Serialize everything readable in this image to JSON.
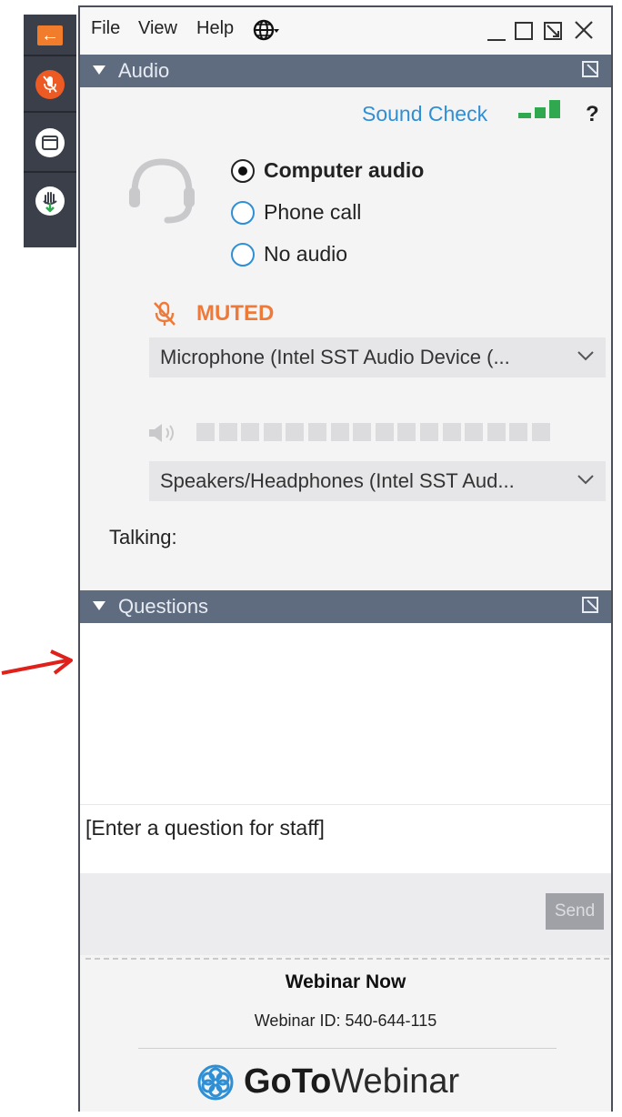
{
  "menubar": {
    "items": [
      "File",
      "View",
      "Help"
    ],
    "language_icon": "globe-icon"
  },
  "side_toolbar": {
    "items": [
      {
        "name": "back-arrow-icon",
        "color": "#f07c2c"
      },
      {
        "name": "microphone-muted-icon",
        "color": "#ee5a24"
      },
      {
        "name": "window-icon",
        "color": "#ffffff"
      },
      {
        "name": "raise-hand-icon",
        "color": "#2fa84f"
      }
    ]
  },
  "audio": {
    "header": "Audio",
    "sound_check": "Sound Check",
    "help": "?",
    "options": [
      {
        "label": "Computer audio",
        "selected": true
      },
      {
        "label": "Phone call",
        "selected": false
      },
      {
        "label": "No audio",
        "selected": false
      }
    ],
    "muted_label": "MUTED",
    "microphone": "Microphone (Intel SST Audio Device (...",
    "speakers": "Speakers/Headphones (Intel SST Aud...",
    "talking": "Talking:"
  },
  "questions": {
    "header": "Questions",
    "placeholder": "[Enter a question for staff]",
    "send": "Send"
  },
  "footer": {
    "webinar_name": "Webinar Now",
    "webinar_id": "Webinar ID: 540-644-115",
    "brand_goto": "GoTo",
    "brand_webinar": "Webinar"
  },
  "colors": {
    "accent_blue": "#2e8fd4",
    "muted_orange": "#ee7a3a",
    "header_bg": "#5f6b7f",
    "signal_green": "#2fa84f",
    "annotation_arrow": "#e0201b"
  }
}
